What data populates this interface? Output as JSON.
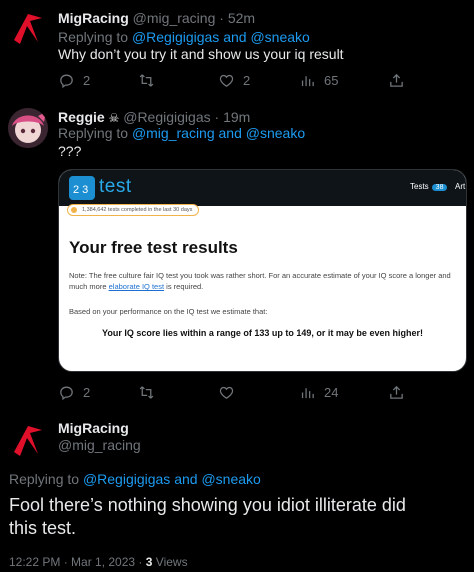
{
  "tweet1": {
    "author": "MigRacing",
    "handle": "@mig_racing",
    "time": "52m",
    "replying_prefix": "Replying to",
    "replying_targets": "@Regigigigas and @sneako",
    "text": "Why don’t you try it and show us your iq result",
    "replies": "2",
    "likes": "2",
    "views": "65"
  },
  "tweet2": {
    "author": "Reggie",
    "handle": "@Regigigigas",
    "time": "19m",
    "replying_prefix": "Replying to",
    "replying_targets": "@mig_racing and @sneako",
    "text": "???",
    "replies": "2",
    "views": "24",
    "image": {
      "logo_text": "test",
      "nav_tests": "Tests",
      "nav_badge": "38",
      "nav_more": "Art",
      "stat_pill": "1,384,642 tests completed in the last 30 days",
      "title": "Your free test results",
      "note_line1": "Note: The free culture fair IQ test you took was rather short. For an accurate estimate of your IQ score a longer and",
      "note_line2_pre": "much more ",
      "note_line2_link": "elaborate IQ test",
      "note_line2_post": " is required.",
      "note_line3": "Based on your performance on the IQ test we estimate that:",
      "score_line": "Your IQ score lies within a range of 133 up to 149, or it may be even higher!"
    }
  },
  "tweet3": {
    "author": "MigRacing",
    "handle": "@mig_racing",
    "replying_prefix": "Replying to",
    "replying_targets": "@Regigigigas and @sneako",
    "text_line1": "Fool there’s nothing showing you idiot illiterate did",
    "text_line2": "this test.",
    "timestamp": "12:22 PM · Mar 1, 2023 ·",
    "views_count": "3",
    "views_label": "Views"
  },
  "colors": {
    "background": "#000000",
    "text_primary": "#e7e9ea",
    "text_secondary": "#71767b",
    "link": "#1d9bf0",
    "brand_red": "#e0102a"
  }
}
